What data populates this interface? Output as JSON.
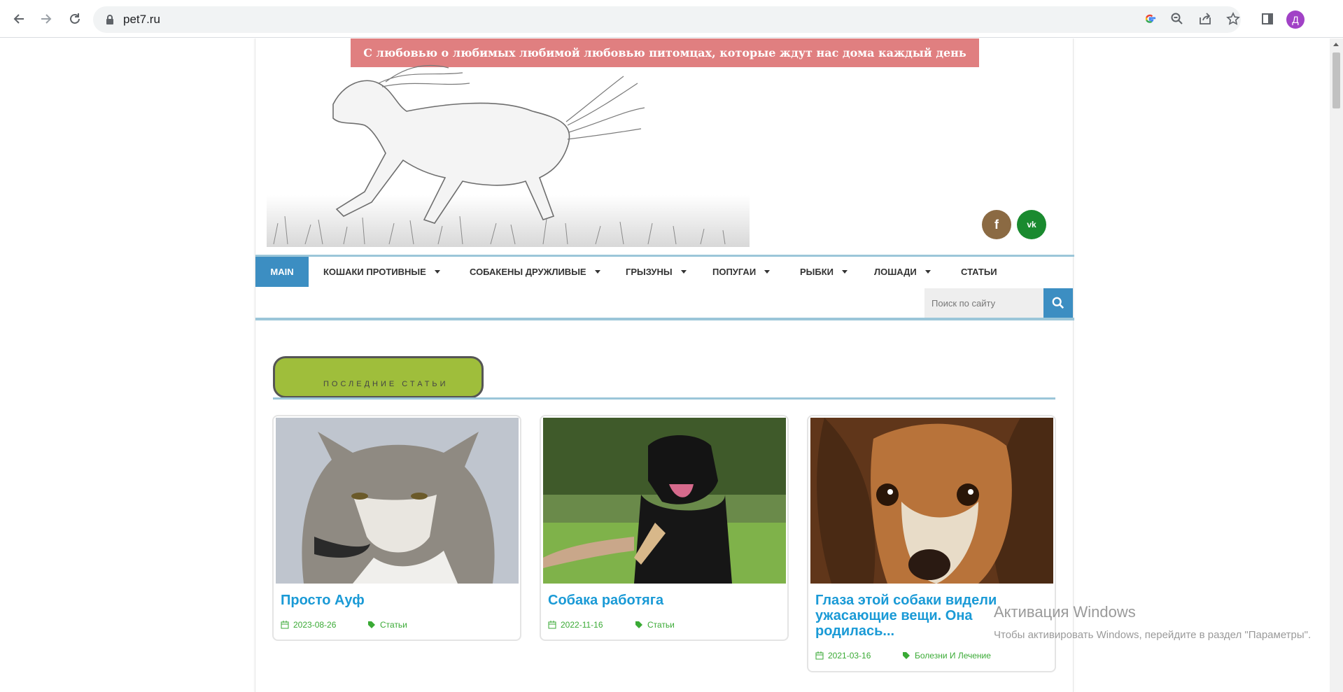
{
  "browser": {
    "url": "pet7.ru",
    "profile_initial": "Д",
    "icons": [
      "back-icon",
      "forward-icon",
      "reload-icon",
      "lock-icon",
      "google-icon",
      "zoom-icon",
      "share-icon",
      "star-icon",
      "sidepanel-icon"
    ]
  },
  "site": {
    "tagline": "С любовью о любимых любимой любовью питомцах, которые ждут нас дома каждый день",
    "social": {
      "facebook": "f",
      "vk": "vk"
    },
    "menu": [
      {
        "label": "MAIN",
        "active": true
      },
      {
        "label": "КОШАКИ ПРОТИВНЫЕ",
        "dropdown": true
      },
      {
        "label": "СОБАКЕНЫ ДРУЖЛИВЫЕ",
        "dropdown": true
      },
      {
        "label": "ГРЫЗУНЫ",
        "dropdown": true
      },
      {
        "label": "ПОПУГАИ",
        "dropdown": true
      },
      {
        "label": "РЫБКИ",
        "dropdown": true
      },
      {
        "label": "ЛОШАДИ",
        "dropdown": true
      },
      {
        "label": "СТАТЬИ",
        "dropdown": false
      }
    ],
    "search": {
      "placeholder": "Поиск по сайту"
    },
    "section_title": "ПОСЛЕДНИЕ СТАТЬИ",
    "articles": [
      {
        "title": "Просто Ауф",
        "date": "2023-08-26",
        "category": "Статьи",
        "image": "wolf"
      },
      {
        "title": "Собака работяга",
        "date": "2022-11-16",
        "category": "Статьи",
        "image": "black-dog"
      },
      {
        "title": "Глаза этой собаки видели ужасающие вещи. Она родилась...",
        "date": "2021-03-16",
        "category": "Болезни И Лечение",
        "image": "beagle"
      }
    ]
  },
  "watermark": {
    "title": "Активация Windows",
    "text": "Чтобы активировать Windows, перейдите в раздел \"Параметры\"."
  },
  "colors": {
    "accent": "#3c8ec2",
    "tagline_bg": "#e07f80",
    "section_pill": "#9fbe3b",
    "title_link": "#1a9ad6",
    "meta_green": "#3aaa35"
  }
}
